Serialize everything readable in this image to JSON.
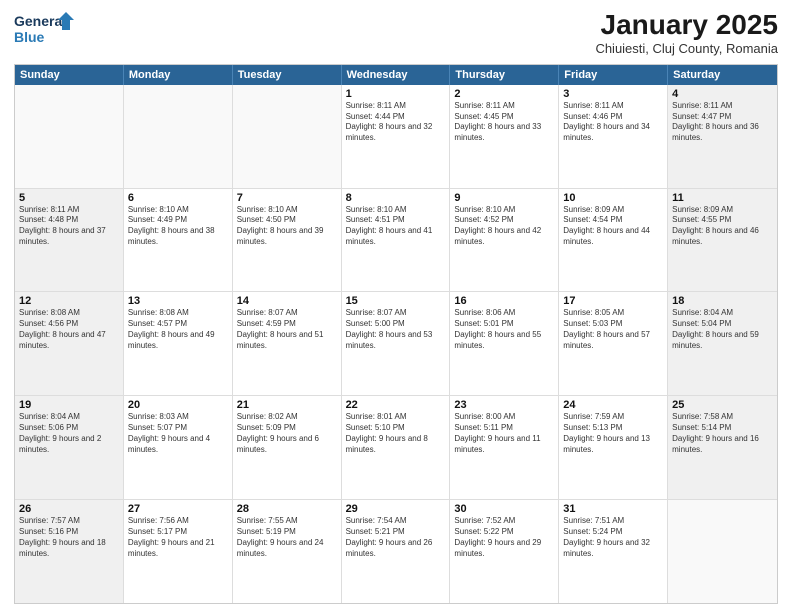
{
  "logo": {
    "line1": "General",
    "line2": "Blue"
  },
  "header": {
    "month": "January 2025",
    "location": "Chiuiesti, Cluj County, Romania"
  },
  "days": [
    "Sunday",
    "Monday",
    "Tuesday",
    "Wednesday",
    "Thursday",
    "Friday",
    "Saturday"
  ],
  "weeks": [
    [
      {
        "day": "",
        "info": ""
      },
      {
        "day": "",
        "info": ""
      },
      {
        "day": "",
        "info": ""
      },
      {
        "day": "1",
        "info": "Sunrise: 8:11 AM\nSunset: 4:44 PM\nDaylight: 8 hours and 32 minutes."
      },
      {
        "day": "2",
        "info": "Sunrise: 8:11 AM\nSunset: 4:45 PM\nDaylight: 8 hours and 33 minutes."
      },
      {
        "day": "3",
        "info": "Sunrise: 8:11 AM\nSunset: 4:46 PM\nDaylight: 8 hours and 34 minutes."
      },
      {
        "day": "4",
        "info": "Sunrise: 8:11 AM\nSunset: 4:47 PM\nDaylight: 8 hours and 36 minutes."
      }
    ],
    [
      {
        "day": "5",
        "info": "Sunrise: 8:11 AM\nSunset: 4:48 PM\nDaylight: 8 hours and 37 minutes."
      },
      {
        "day": "6",
        "info": "Sunrise: 8:10 AM\nSunset: 4:49 PM\nDaylight: 8 hours and 38 minutes."
      },
      {
        "day": "7",
        "info": "Sunrise: 8:10 AM\nSunset: 4:50 PM\nDaylight: 8 hours and 39 minutes."
      },
      {
        "day": "8",
        "info": "Sunrise: 8:10 AM\nSunset: 4:51 PM\nDaylight: 8 hours and 41 minutes."
      },
      {
        "day": "9",
        "info": "Sunrise: 8:10 AM\nSunset: 4:52 PM\nDaylight: 8 hours and 42 minutes."
      },
      {
        "day": "10",
        "info": "Sunrise: 8:09 AM\nSunset: 4:54 PM\nDaylight: 8 hours and 44 minutes."
      },
      {
        "day": "11",
        "info": "Sunrise: 8:09 AM\nSunset: 4:55 PM\nDaylight: 8 hours and 46 minutes."
      }
    ],
    [
      {
        "day": "12",
        "info": "Sunrise: 8:08 AM\nSunset: 4:56 PM\nDaylight: 8 hours and 47 minutes."
      },
      {
        "day": "13",
        "info": "Sunrise: 8:08 AM\nSunset: 4:57 PM\nDaylight: 8 hours and 49 minutes."
      },
      {
        "day": "14",
        "info": "Sunrise: 8:07 AM\nSunset: 4:59 PM\nDaylight: 8 hours and 51 minutes."
      },
      {
        "day": "15",
        "info": "Sunrise: 8:07 AM\nSunset: 5:00 PM\nDaylight: 8 hours and 53 minutes."
      },
      {
        "day": "16",
        "info": "Sunrise: 8:06 AM\nSunset: 5:01 PM\nDaylight: 8 hours and 55 minutes."
      },
      {
        "day": "17",
        "info": "Sunrise: 8:05 AM\nSunset: 5:03 PM\nDaylight: 8 hours and 57 minutes."
      },
      {
        "day": "18",
        "info": "Sunrise: 8:04 AM\nSunset: 5:04 PM\nDaylight: 8 hours and 59 minutes."
      }
    ],
    [
      {
        "day": "19",
        "info": "Sunrise: 8:04 AM\nSunset: 5:06 PM\nDaylight: 9 hours and 2 minutes."
      },
      {
        "day": "20",
        "info": "Sunrise: 8:03 AM\nSunset: 5:07 PM\nDaylight: 9 hours and 4 minutes."
      },
      {
        "day": "21",
        "info": "Sunrise: 8:02 AM\nSunset: 5:09 PM\nDaylight: 9 hours and 6 minutes."
      },
      {
        "day": "22",
        "info": "Sunrise: 8:01 AM\nSunset: 5:10 PM\nDaylight: 9 hours and 8 minutes."
      },
      {
        "day": "23",
        "info": "Sunrise: 8:00 AM\nSunset: 5:11 PM\nDaylight: 9 hours and 11 minutes."
      },
      {
        "day": "24",
        "info": "Sunrise: 7:59 AM\nSunset: 5:13 PM\nDaylight: 9 hours and 13 minutes."
      },
      {
        "day": "25",
        "info": "Sunrise: 7:58 AM\nSunset: 5:14 PM\nDaylight: 9 hours and 16 minutes."
      }
    ],
    [
      {
        "day": "26",
        "info": "Sunrise: 7:57 AM\nSunset: 5:16 PM\nDaylight: 9 hours and 18 minutes."
      },
      {
        "day": "27",
        "info": "Sunrise: 7:56 AM\nSunset: 5:17 PM\nDaylight: 9 hours and 21 minutes."
      },
      {
        "day": "28",
        "info": "Sunrise: 7:55 AM\nSunset: 5:19 PM\nDaylight: 9 hours and 24 minutes."
      },
      {
        "day": "29",
        "info": "Sunrise: 7:54 AM\nSunset: 5:21 PM\nDaylight: 9 hours and 26 minutes."
      },
      {
        "day": "30",
        "info": "Sunrise: 7:52 AM\nSunset: 5:22 PM\nDaylight: 9 hours and 29 minutes."
      },
      {
        "day": "31",
        "info": "Sunrise: 7:51 AM\nSunset: 5:24 PM\nDaylight: 9 hours and 32 minutes."
      },
      {
        "day": "",
        "info": ""
      }
    ]
  ]
}
